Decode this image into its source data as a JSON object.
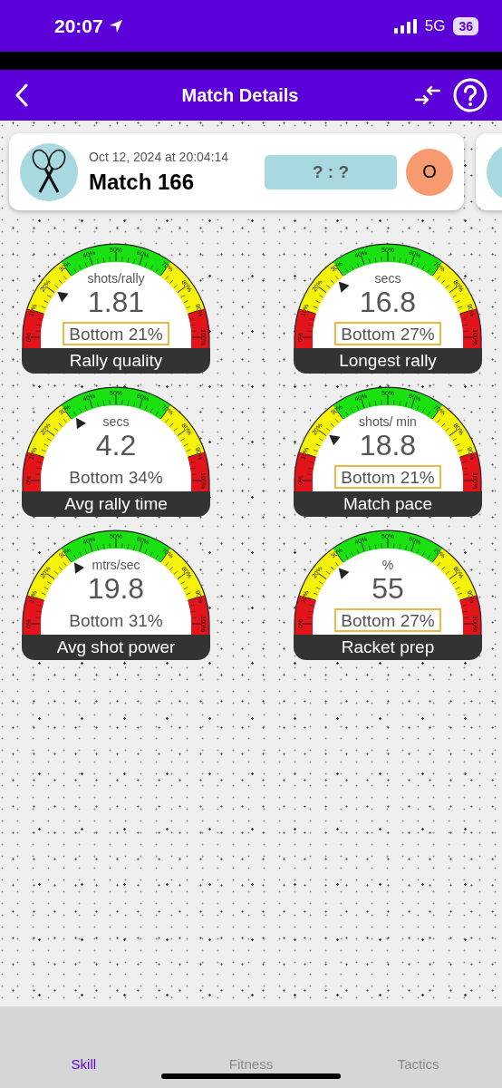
{
  "status_bar": {
    "time": "20:07",
    "network": "5G",
    "battery": "36"
  },
  "nav": {
    "title": "Match Details"
  },
  "match": {
    "date": "Oct 12, 2024 at 20:04:14",
    "title": "Match 166",
    "score": "? : ?",
    "badge": "O"
  },
  "gauges": [
    {
      "unit": "shots/rally",
      "value": "1.81",
      "percentile": "Bottom 21%",
      "highlighted": true,
      "title": "Rally quality",
      "level": 0.21,
      "scale": [
        "0%",
        "10%",
        "20%",
        "30%",
        "40%",
        "50%",
        "60%",
        "70%",
        "80%",
        "90%",
        "100%"
      ]
    },
    {
      "unit": "secs",
      "value": "16.8",
      "percentile": "Bottom 27%",
      "highlighted": true,
      "title": "Longest rally",
      "level": 0.27,
      "scale": [
        "0%",
        "10%",
        "20%",
        "30%",
        "40%",
        "50%",
        "60%",
        "70%",
        "80%",
        "90%",
        "100%"
      ]
    },
    {
      "unit": "secs",
      "value": "4.2",
      "percentile": "Bottom 34%",
      "highlighted": false,
      "title": "Avg rally time",
      "level": 0.32,
      "scale": [
        "0%",
        "10%",
        "20%",
        "30%",
        "40%",
        "50%",
        "60%",
        "70%",
        "80%",
        "90%",
        "100%"
      ]
    },
    {
      "unit": "shots/ min",
      "value": "18.8",
      "percentile": "Bottom 21%",
      "highlighted": true,
      "title": "Match pace",
      "level": 0.21,
      "scale": [
        "0%",
        "10%",
        "20%",
        "30%",
        "40%",
        "50%",
        "60%",
        "70%",
        "80%",
        "90%",
        "100%"
      ]
    },
    {
      "unit": "mtrs/sec",
      "value": "19.8",
      "percentile": "Bottom 31%",
      "highlighted": false,
      "title": "Avg shot power",
      "level": 0.31,
      "scale": [
        "0%",
        "10%",
        "20%",
        "30%",
        "40%",
        "50%",
        "60%",
        "70%",
        "80%",
        "90%",
        "100%"
      ]
    },
    {
      "unit": "%",
      "value": "55",
      "percentile": "Bottom 27%",
      "highlighted": true,
      "title": "Racket prep",
      "level": 0.27,
      "scale": [
        "0%",
        "10%",
        "20%",
        "30%",
        "40%",
        "50%",
        "60%",
        "70%",
        "80%",
        "90%",
        "100%"
      ]
    }
  ],
  "tabs": [
    {
      "label": "Skill",
      "selected": true
    },
    {
      "label": "Fitness",
      "selected": false
    },
    {
      "label": "Tactics",
      "selected": false
    }
  ]
}
